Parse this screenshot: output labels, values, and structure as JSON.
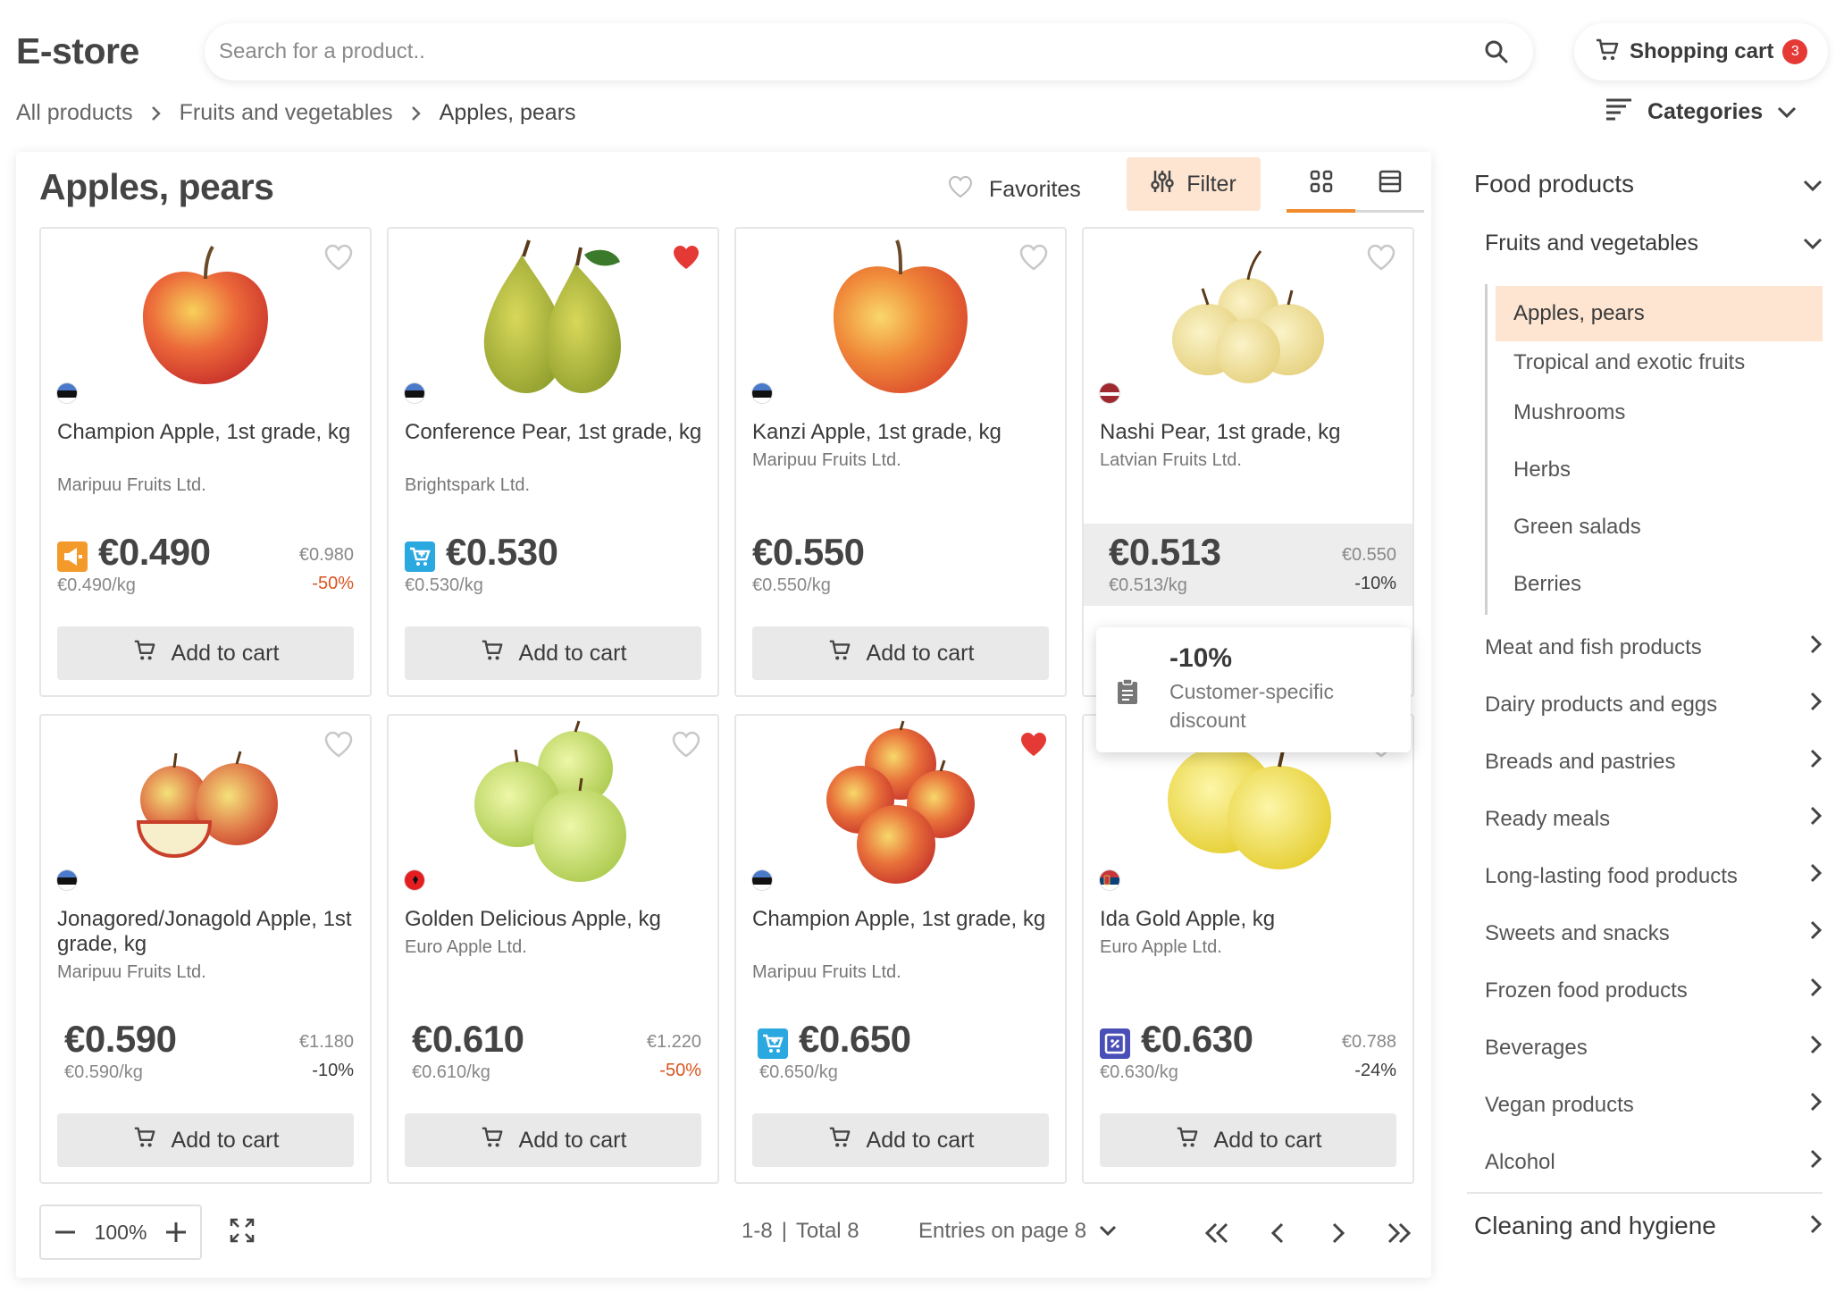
{
  "header": {
    "logo": "E-store",
    "search_placeholder": "Search for a product..",
    "cart_label": "Shopping cart",
    "cart_count": "3"
  },
  "breadcrumb": {
    "items": [
      "All products",
      "Fruits and vegetables",
      "Apples, pears"
    ]
  },
  "categories_label": "Categories",
  "main": {
    "title": "Apples, pears",
    "favorites_label": "Favorites",
    "filter_label": "Filter",
    "active_view": "grid"
  },
  "products": [
    {
      "name": "Champion Apple, 1st grade, kg",
      "supplier": "Maripuu Fruits Ltd.",
      "price": "€0.490",
      "old_price": "€0.980",
      "unit_price": "€0.490/kg",
      "discount": "-50%",
      "badge": "megaphone",
      "favorite": false,
      "country": "Estonia",
      "add_label": "Add to cart"
    },
    {
      "name": "Conference Pear, 1st grade, kg",
      "supplier": "Brightspark Ltd.",
      "price": "€0.530",
      "old_price": "",
      "unit_price": "€0.530/kg",
      "discount": "",
      "badge": "cart-plus",
      "favorite": true,
      "country": "Estonia",
      "add_label": "Add to cart"
    },
    {
      "name": "Kanzi Apple, 1st grade, kg",
      "supplier": "Maripuu Fruits Ltd.",
      "price": "€0.550",
      "old_price": "",
      "unit_price": "€0.550/kg",
      "discount": "",
      "badge": "",
      "favorite": false,
      "country": "Estonia",
      "add_label": "Add to cart"
    },
    {
      "name": "Nashi Pear, 1st grade, kg",
      "supplier": "Latvian Fruits Ltd.",
      "price": "€0.513",
      "old_price": "€0.550",
      "unit_price": "€0.513/kg",
      "discount": "-10%",
      "badge": "",
      "favorite": false,
      "country": "Latvia",
      "add_label": "Add to cart"
    },
    {
      "name": "Jonagored/Jonagold Apple, 1st grade, kg",
      "supplier": "Maripuu Fruits Ltd.",
      "price": "€0.590",
      "old_price": "€1.180",
      "unit_price": "€0.590/kg",
      "discount": "-10%",
      "badge": "",
      "favorite": false,
      "country": "Estonia",
      "add_label": "Add to cart"
    },
    {
      "name": "Golden Delicious Apple, kg",
      "supplier": "Euro Apple Ltd.",
      "price": "€0.610",
      "old_price": "€1.220",
      "unit_price": "€0.610/kg",
      "discount": "-50%",
      "badge": "",
      "favorite": false,
      "country": "Albania",
      "add_label": "Add to cart"
    },
    {
      "name": "Champion Apple, 1st grade, kg",
      "supplier": "Maripuu Fruits Ltd.",
      "price": "€0.650",
      "old_price": "",
      "unit_price": "€0.650/kg",
      "discount": "",
      "badge": "cart-plus",
      "favorite": true,
      "country": "Estonia",
      "add_label": "Add to cart"
    },
    {
      "name": "Ida Gold Apple, kg",
      "supplier": "Euro Apple Ltd.",
      "price": "€0.630",
      "old_price": "€0.788",
      "unit_price": "€0.630/kg",
      "discount": "-24%",
      "badge": "discount-tag",
      "favorite": false,
      "country": "Serbia",
      "add_label": "Add to cart"
    }
  ],
  "tooltip": {
    "title": "-10%",
    "description": "Customer-specific discount"
  },
  "footer": {
    "zoom": "100%",
    "range": "1-8",
    "total": "Total 8",
    "entries_label": "Entries on page 8"
  },
  "sidebar": {
    "top_category": "Food products",
    "sub_category": "Fruits and vegetables",
    "leaves": [
      "Apples, pears",
      "Tropical and exotic fruits",
      "Mushrooms",
      "Herbs",
      "Green salads",
      "Berries"
    ],
    "categories": [
      "Meat and fish products",
      "Dairy products and eggs",
      "Breads and pastries",
      "Ready meals",
      "Long-lasting food products",
      "Sweets and snacks",
      "Frozen food products",
      "Beverages",
      "Vegan products",
      "Alcohol"
    ],
    "bottom_category": "Cleaning and hygiene"
  },
  "colors": {
    "accent": "#f08a2c",
    "accent_light": "#fde5d2",
    "heart": "#e53935",
    "discount": "#d9541e",
    "badge_orange": "#f39a2a",
    "badge_blue": "#2aa8e0",
    "badge_indigo": "#4a4fb8"
  }
}
